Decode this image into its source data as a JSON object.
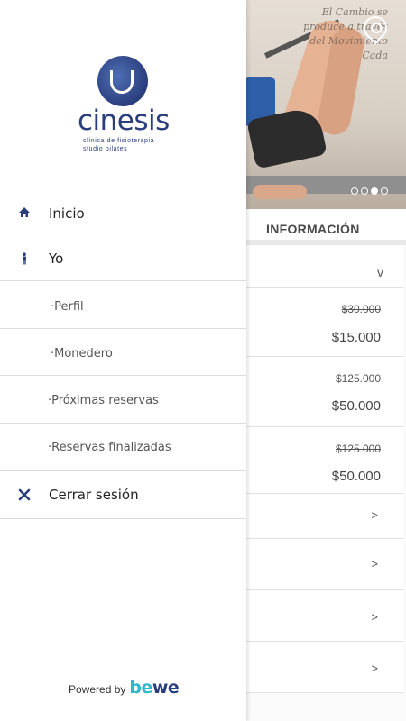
{
  "background": {
    "hero": {
      "wall_text": "El Cambio se produce a través del Movimiento Cada",
      "carousel_dots": [
        false,
        false,
        true,
        false
      ]
    },
    "section_title": "INFORMACIÓN",
    "cards": [
      {
        "kind": "dropdown",
        "chevron": "v"
      },
      {
        "kind": "price",
        "old_price": "$30.000",
        "new_price": "$15.000"
      },
      {
        "kind": "price",
        "old_price": "$125.000",
        "new_price": "$50.000"
      },
      {
        "kind": "price",
        "old_price": "$125.000",
        "new_price": "$50.000"
      },
      {
        "kind": "link",
        "chevron": ">"
      },
      {
        "kind": "link",
        "chevron": ">"
      },
      {
        "kind": "link",
        "chevron": ">"
      },
      {
        "kind": "link",
        "chevron": ">"
      }
    ]
  },
  "drawer": {
    "logo": {
      "wordmark": "cinesis",
      "line1": "clínica de fisioterapia",
      "line2": "studio pilates"
    },
    "menu": {
      "inicio": {
        "label": "Inicio",
        "icon": "home-icon"
      },
      "yo": {
        "label": "Yo",
        "icon": "person-icon"
      },
      "perfil": {
        "label": "·Perfil"
      },
      "monedero": {
        "label": "·Monedero"
      },
      "proximas": {
        "label": "·Próximas reservas"
      },
      "finalizadas": {
        "label": "·Reservas finalizadas"
      },
      "cerrar": {
        "label": "Cerrar sesión",
        "icon": "close-icon"
      }
    },
    "powered_by": "Powered by",
    "brand": {
      "part1": "be",
      "part2": "we"
    }
  },
  "colors": {
    "brand_navy": "#2a3e7d",
    "brand_teal": "#2fb8c9"
  }
}
